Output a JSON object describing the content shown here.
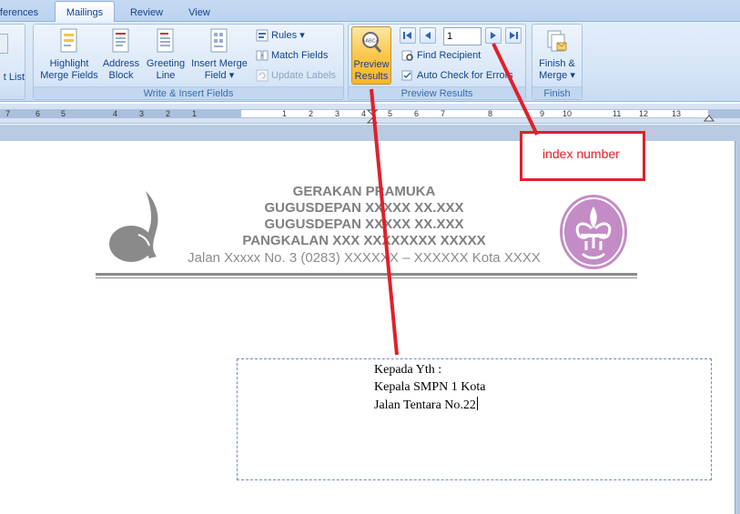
{
  "tabs": [
    {
      "label": "ferences",
      "active": false
    },
    {
      "label": "Mailings",
      "active": true
    },
    {
      "label": "Review",
      "active": false
    },
    {
      "label": "View",
      "active": false
    }
  ],
  "ribbon": {
    "partial_group": {
      "label_fragment": "t List"
    },
    "write_insert": {
      "label": "Write & Insert Fields",
      "highlight": {
        "line1": "Highlight",
        "line2": "Merge Fields"
      },
      "address_block": {
        "line1": "Address",
        "line2": "Block"
      },
      "greeting_line": {
        "line1": "Greeting",
        "line2": "Line"
      },
      "insert_merge_field": {
        "line1": "Insert Merge",
        "line2": "Field"
      },
      "rules": "Rules",
      "match_fields": "Match Fields",
      "update_labels": "Update Labels"
    },
    "preview_results": {
      "label": "Preview Results",
      "preview_button": {
        "line1": "Preview",
        "line2": "Results"
      },
      "record_number": "1",
      "find_recipient": "Find Recipient",
      "auto_check": "Auto Check for Errors"
    },
    "finish": {
      "label": "Finish",
      "finish_merge": {
        "line1": "Finish &",
        "line2": "Merge"
      }
    }
  },
  "ruler": {
    "numbers_left": [
      "7",
      "6",
      "5",
      "4",
      "3",
      "2",
      "1"
    ],
    "numbers_right": [
      "1",
      "2",
      "3",
      "4",
      "5",
      "6",
      "7",
      "8",
      "9",
      "10",
      "11",
      "12",
      "13"
    ]
  },
  "document": {
    "letterhead": {
      "line1": "GERAKAN PRAMUKA",
      "line2": "GUGUSDEPAN XXXXX XX.XXX",
      "line3": "GUGUSDEPAN XXXXX XX.XXX",
      "line4": "PANGKALAN XXX XXXXXXXX XXXXX",
      "address": "Jalan Xxxxx No. 3 (0283) XXXXXX – XXXXXX Kota XXXX"
    },
    "recipient": {
      "line1": "Kepada Yth :",
      "line2": "Kepala SMPN 1 Kota",
      "line3": "Jalan Tentara No.22"
    }
  },
  "annotation": {
    "text": "index number",
    "color": "#e0202a"
  },
  "colors": {
    "ribbon_text": "#15428b",
    "preview_active": "#fbc64c",
    "emblem_purple": "#c38cc6"
  }
}
